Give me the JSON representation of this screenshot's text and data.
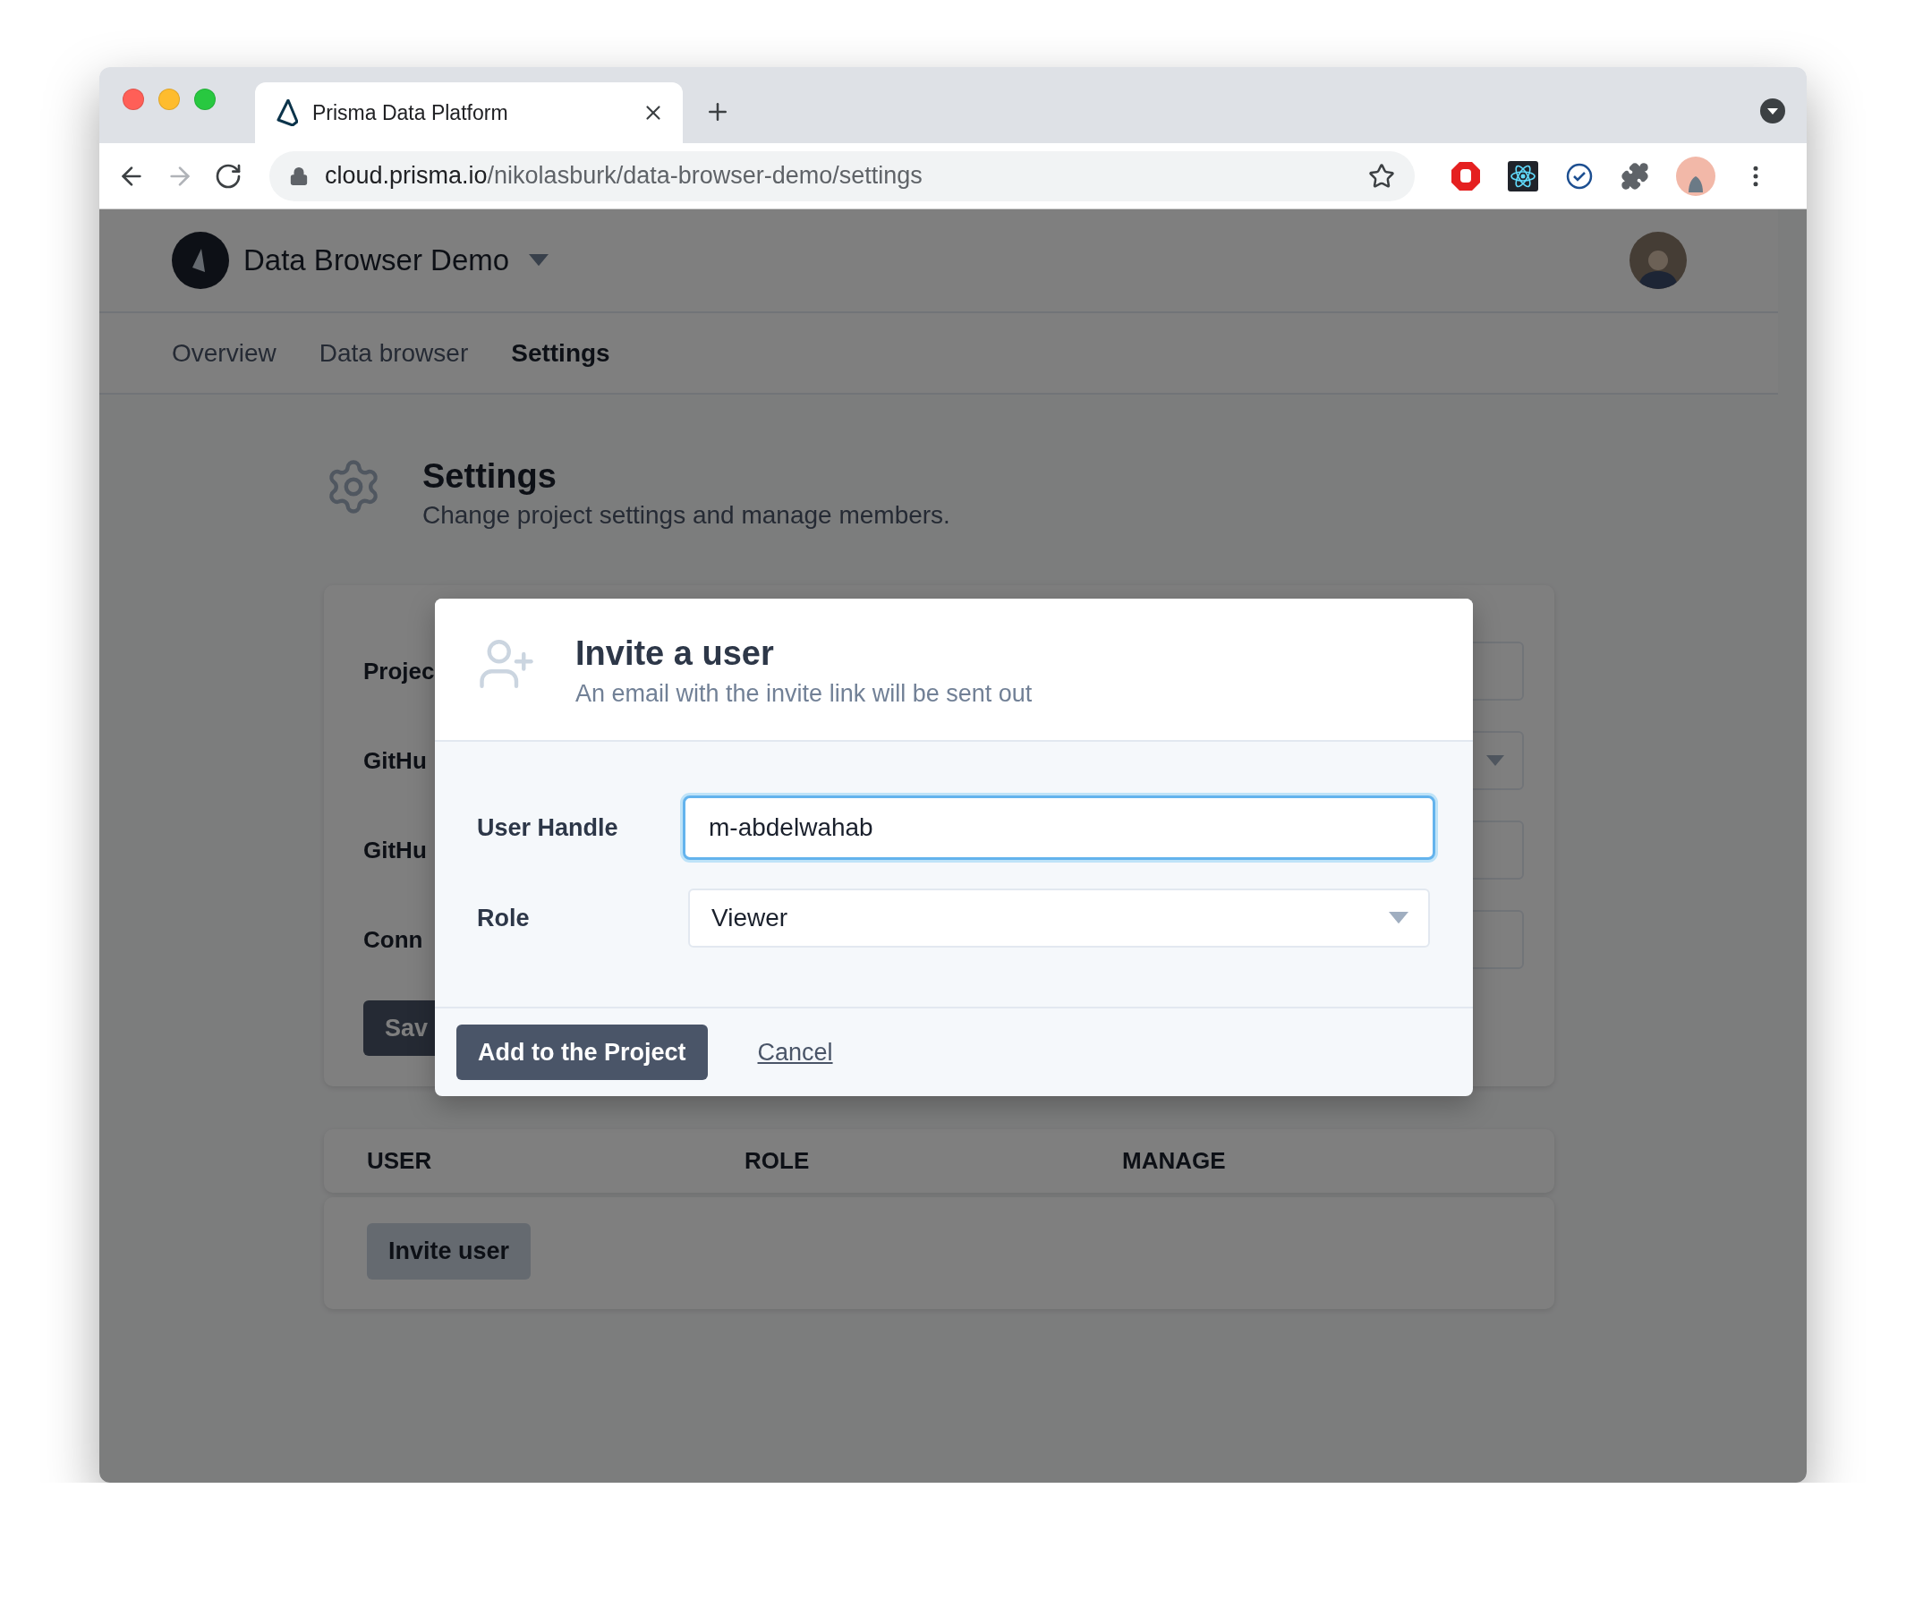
{
  "browser": {
    "tab": {
      "title": "Prisma Data Platform"
    },
    "nav_buttons": [
      {
        "kind": "back",
        "disabled": false
      },
      {
        "kind": "forward",
        "disabled": true
      },
      {
        "kind": "reload",
        "disabled": false
      }
    ],
    "address": {
      "host": "cloud.prisma.io",
      "path": "/nikolasburk/data-browser-demo/settings"
    }
  },
  "project": {
    "name": "Data Browser Demo"
  },
  "nav_tabs": [
    {
      "label": "Overview",
      "selected": false
    },
    {
      "label": "Data browser",
      "selected": false
    },
    {
      "label": "Settings",
      "selected": true
    }
  ],
  "settings_header": {
    "title": "Settings",
    "subtitle": "Change project settings and manage members."
  },
  "project_form": {
    "fields": [
      {
        "label": "Projec",
        "kind": "input"
      },
      {
        "label": "GitHu",
        "kind": "select"
      },
      {
        "label": "GitHu",
        "kind": "input"
      },
      {
        "label": "Conn",
        "kind": "input"
      }
    ],
    "save_button": "Sav"
  },
  "members": {
    "columns": [
      "USER",
      "ROLE",
      "MANAGE"
    ],
    "invite_button": "Invite user"
  },
  "modal": {
    "title": "Invite a user",
    "subtitle": "An email with the invite link will be sent out",
    "fields": [
      {
        "label": "User Handle",
        "kind": "text",
        "value": "m-abdelwahab",
        "focused": true
      },
      {
        "label": "Role",
        "kind": "select",
        "value": "Viewer",
        "focused": false
      }
    ],
    "submit": "Add to the Project",
    "cancel": "Cancel"
  }
}
